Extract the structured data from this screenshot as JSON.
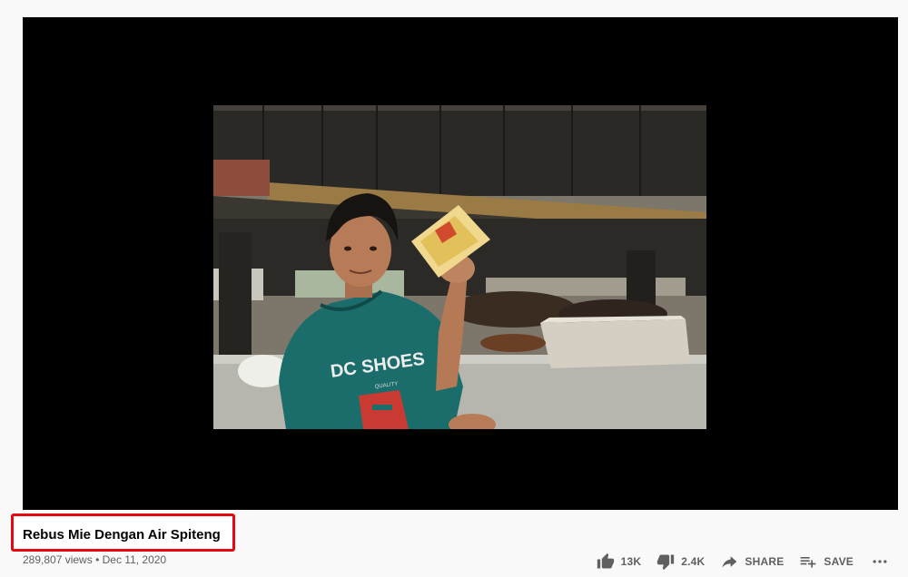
{
  "video": {
    "title": "Rebus Mie Dengan Air Spiteng",
    "views": "289,807 views",
    "separator": "•",
    "date": "Dec 11, 2020",
    "shirt_text": "DC SHOES",
    "shirt_subtext": "QUALITY"
  },
  "actions": {
    "like_count": "13K",
    "dislike_count": "2.4K",
    "share_label": "SHARE",
    "save_label": "SAVE"
  },
  "icons": {
    "like": "thumbs-up-icon",
    "dislike": "thumbs-down-icon",
    "share": "share-arrow-icon",
    "save": "playlist-add-icon",
    "more": "more-horizontal-icon"
  },
  "colors": {
    "page_background": "#f9f9f9",
    "player_background": "#000000",
    "highlight_border": "#e50914",
    "secondary_text": "#606060"
  }
}
